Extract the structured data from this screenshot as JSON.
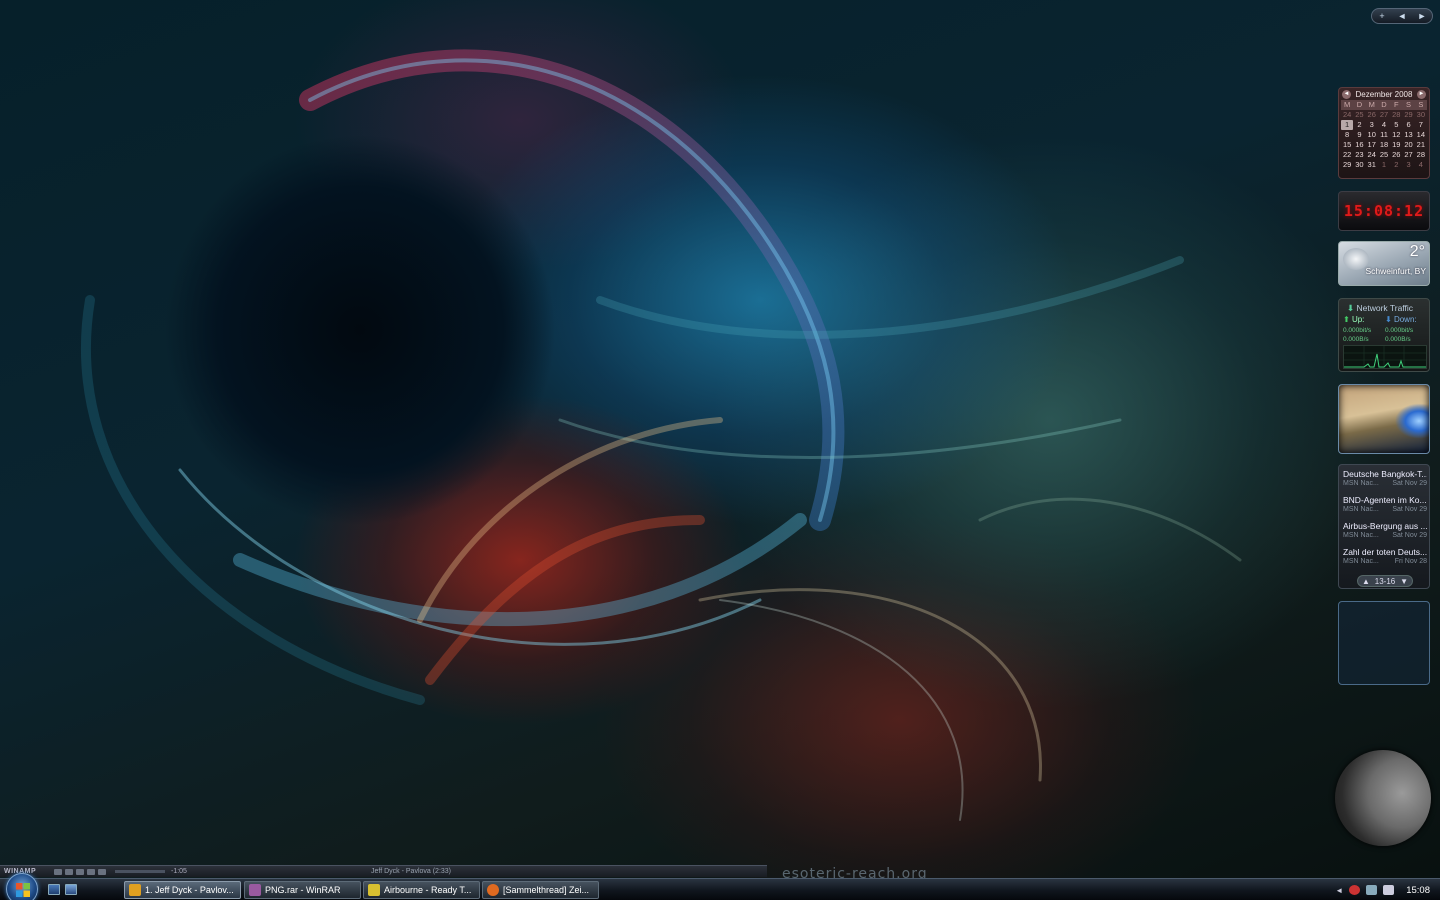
{
  "wallpaper": {
    "signature": "esoteric-reach.org"
  },
  "sidebar": {
    "controls": [
      "+",
      "◄",
      "►"
    ],
    "calendar": {
      "month": "Dezember 2008",
      "weekdays": [
        "M",
        "D",
        "M",
        "D",
        "F",
        "S",
        "S"
      ],
      "weeks": [
        [
          "24",
          "25",
          "26",
          "27",
          "28",
          "29",
          "30"
        ],
        [
          "1",
          "2",
          "3",
          "4",
          "5",
          "6",
          "7"
        ],
        [
          "8",
          "9",
          "10",
          "11",
          "12",
          "13",
          "14"
        ],
        [
          "15",
          "16",
          "17",
          "18",
          "19",
          "20",
          "21"
        ],
        [
          "22",
          "23",
          "24",
          "25",
          "26",
          "27",
          "28"
        ],
        [
          "29",
          "30",
          "31",
          "1",
          "2",
          "3",
          "4"
        ]
      ],
      "today": "1"
    },
    "clock": {
      "time": "15:08:12"
    },
    "weather": {
      "temperature": "2°",
      "location": "Schweinfurt, BY"
    },
    "network": {
      "title": "Network Traffic",
      "up_label": "Up:",
      "down_label": "Down:",
      "up_bits": "0.000bit/s",
      "down_bits": "0.000bit/s",
      "up_bytes": "0.000B/s",
      "down_bytes": "0.000B/s"
    },
    "news": {
      "items": [
        {
          "title": "Deutsche Bangkok-T...",
          "source": "MSN Nac...",
          "date": "Sat Nov 29"
        },
        {
          "title": "BND-Agenten im Ko...",
          "source": "MSN Nac...",
          "date": "Sat Nov 29"
        },
        {
          "title": "Airbus-Bergung aus ...",
          "source": "MSN Nac...",
          "date": "Sat Nov 29"
        },
        {
          "title": "Zahl der toten Deuts...",
          "source": "MSN Nac...",
          "date": "Fri Nov 28"
        }
      ],
      "pager": "13-16"
    }
  },
  "winamp": {
    "logo": "WINAMP",
    "time": "-1:05",
    "track": "Jeff Dyck - Pavlova (2:33)"
  },
  "taskbar": {
    "tasks": [
      {
        "label": "1. Jeff Dyck - Pavlov...",
        "icon_color": "#e0a020",
        "icon": "winamp-icon",
        "active": true
      },
      {
        "label": "PNG.rar - WinRAR",
        "icon_color": "#9a5aa0",
        "icon": "winrar-icon",
        "active": false
      },
      {
        "label": "Airbourne - Ready T...",
        "icon_color": "#d8c030",
        "icon": "folder-icon",
        "active": false
      },
      {
        "label": "[Sammelthread] Zei...",
        "icon_color": "#e06a20",
        "icon": "firefox-icon",
        "active": false
      }
    ],
    "clock": "15:08"
  },
  "colors": {
    "clock_digits": "#e01a1a",
    "calendar_bg": "#3a2527",
    "taskbar_bg": "#10161e"
  }
}
